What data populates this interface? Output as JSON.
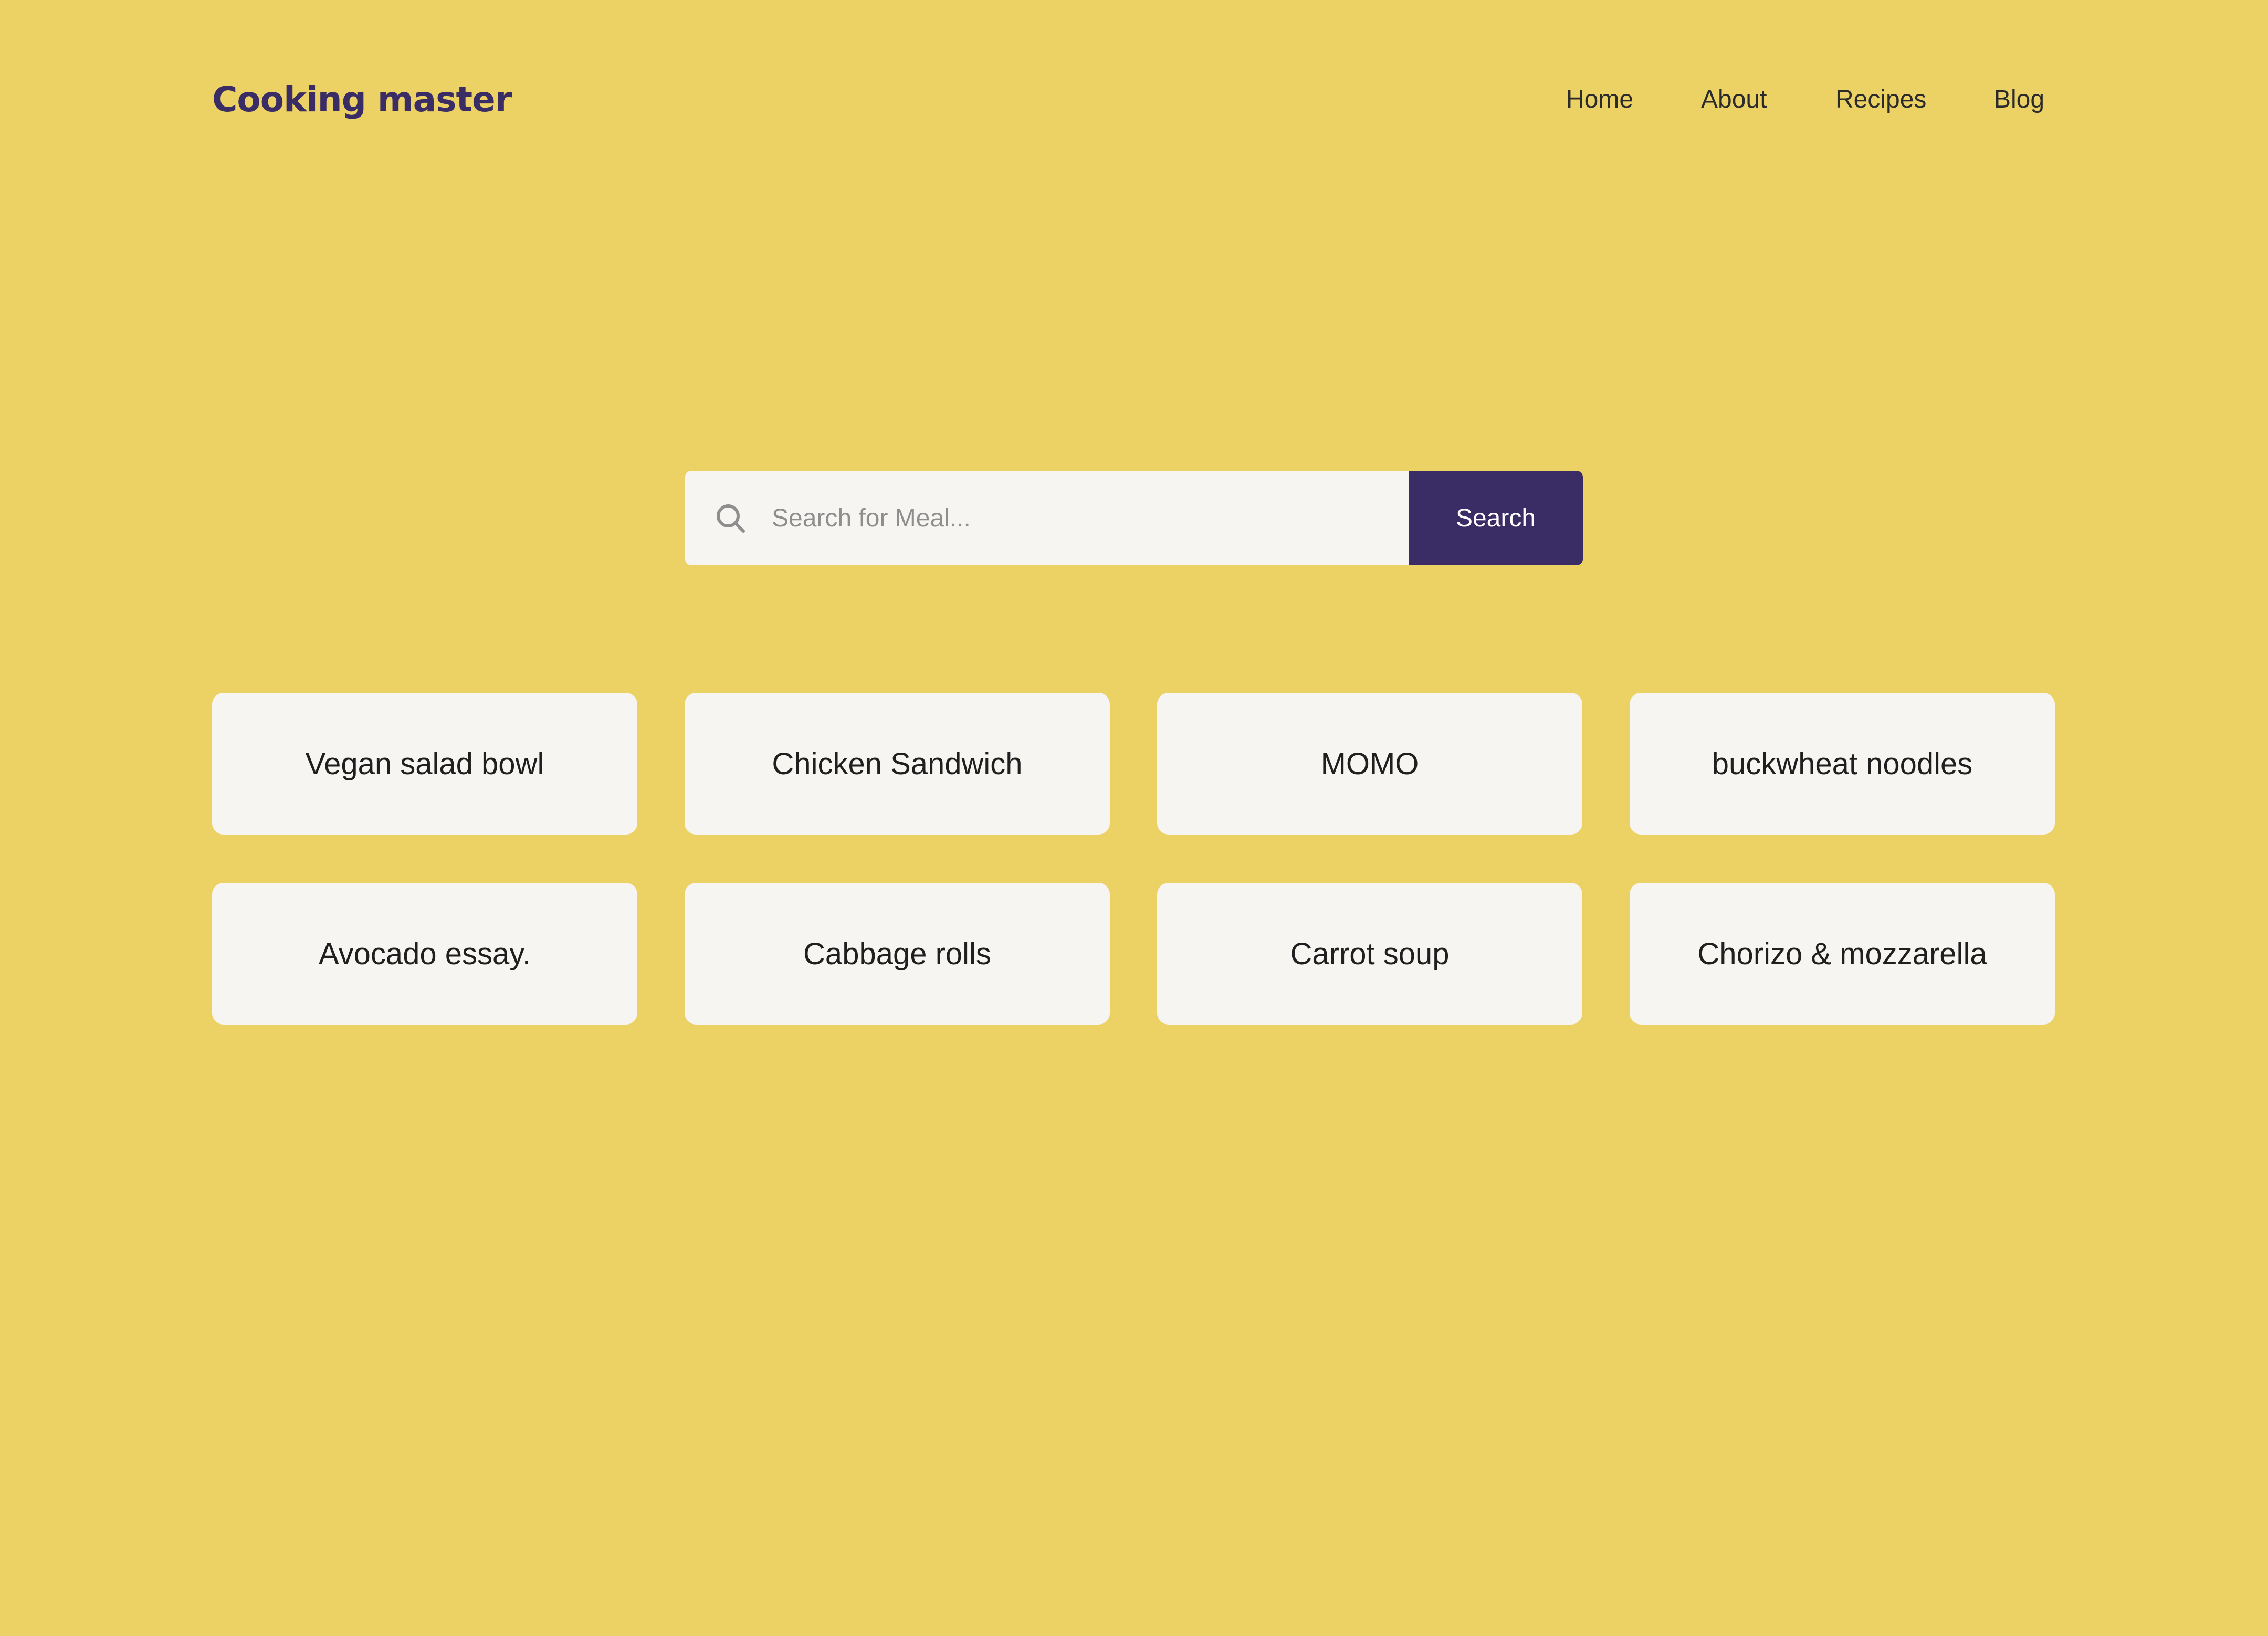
{
  "header": {
    "brand": "Cooking master",
    "nav": [
      "Home",
      "About",
      "Recipes",
      "Blog"
    ]
  },
  "search": {
    "placeholder": "Search for Meal...",
    "value": "",
    "button_label": "Search",
    "icon": "search-icon"
  },
  "meals": [
    "Vegan salad bowl",
    "Chicken Sandwich",
    "MOMO",
    "buckwheat noodles",
    "Avocado essay.",
    "Cabbage rolls",
    "Carrot soup",
    "Chorizo & mozzarella"
  ],
  "colors": {
    "background": "#ECD164",
    "brand": "#3A2C64",
    "card": "#F7F5F2",
    "button": "#3A2C64"
  }
}
